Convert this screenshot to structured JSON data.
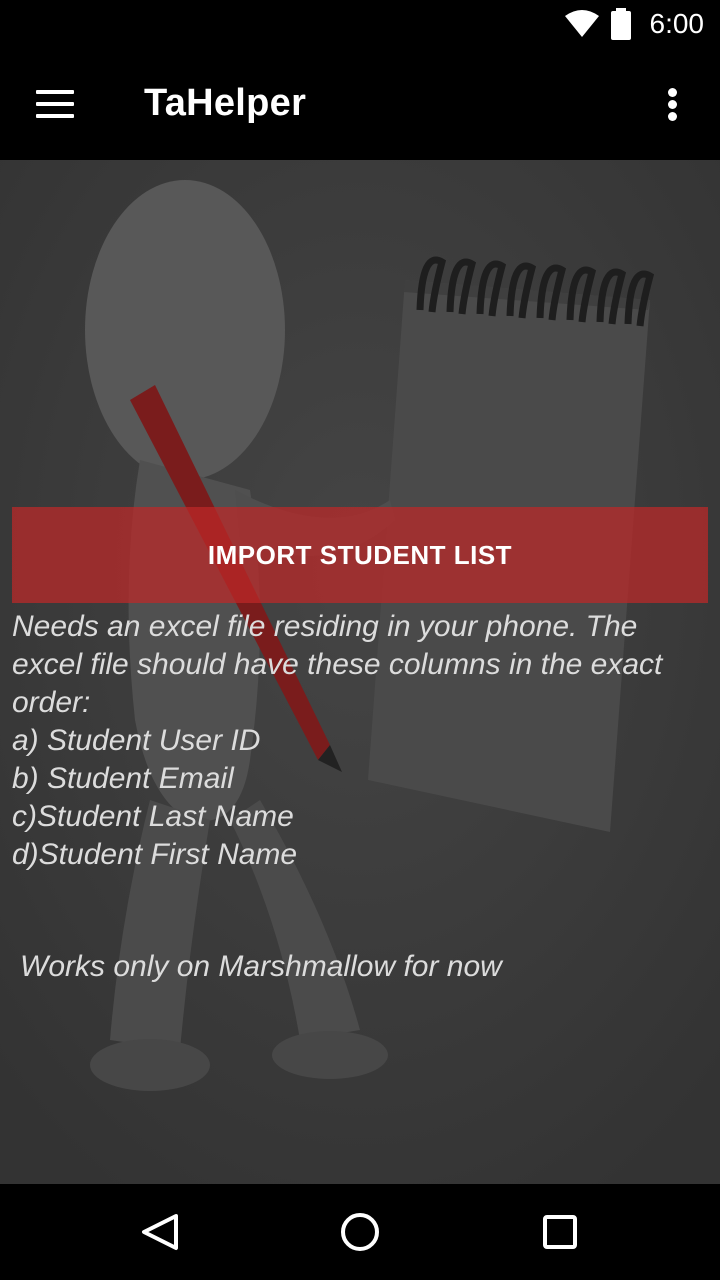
{
  "status_bar": {
    "time": "6:00",
    "icons": [
      "wifi-icon",
      "battery-icon"
    ]
  },
  "app_bar": {
    "title": "TaHelper",
    "menu_icon": "hamburger-menu-icon",
    "overflow_icon": "more-vert-icon"
  },
  "main": {
    "import_button_label": "IMPORT STUDENT LIST",
    "instructions": {
      "intro": "Needs an excel file residing in your phone. The excel file should have these columns in the exact order:",
      "columns": [
        "a) Student User ID",
        "b) Student Email",
        "c)Student Last Name",
        "d)Student First Name"
      ]
    },
    "note": "Works only on Marshmallow for now"
  },
  "nav_bar": {
    "back_icon": "back-triangle-icon",
    "home_icon": "home-circle-icon",
    "recents_icon": "recents-square-icon"
  },
  "colors": {
    "app_bar": "#000000",
    "content_bg": "#383838",
    "button_accent": "#be2828",
    "text": "#dcdcdc"
  }
}
